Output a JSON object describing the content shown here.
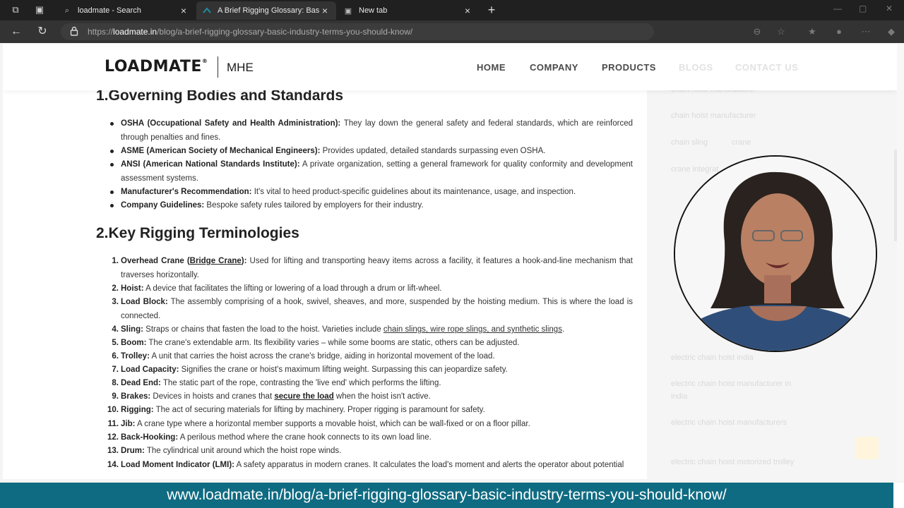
{
  "browser": {
    "tabs": [
      {
        "title": "loadmate - Search",
        "icon": "search-icon"
      },
      {
        "title": "A Brief Rigging Glossary: Basic Ind",
        "icon": "site-favicon"
      },
      {
        "title": "New tab",
        "icon": "newtab-icon"
      }
    ],
    "url": {
      "scheme": "https://",
      "host": "loadmate.in",
      "path": "/blog/a-brief-rigging-glossary-basic-industry-terms-you-should-know/"
    }
  },
  "site": {
    "logo": {
      "brand": "LOADMATE",
      "reg": "®",
      "sub": "MHE"
    },
    "nav": [
      "HOME",
      "COMPANY",
      "PRODUCTS",
      "BLOGS",
      "CONTACT US"
    ]
  },
  "article": {
    "section1": {
      "heading": "1.Governing Bodies and Standards",
      "items": [
        {
          "term": "OSHA (Occupational Safety and Health Administration):",
          "text": " They lay down the general safety and federal standards, which are reinforced through penalties and fines."
        },
        {
          "term": "ASME (American Society of Mechanical Engineers):",
          "text": " Provides updated, detailed standards surpassing even OSHA."
        },
        {
          "term": "ANSI (American National Standards Institute):",
          "text": " A private organization, setting a general framework for quality conformity and development assessment systems."
        },
        {
          "term": "Manufacturer's Recommendation:",
          "text": " It's vital to heed product-specific guidelines about its maintenance, usage, and inspection."
        },
        {
          "term": "Company Guidelines:",
          "text": " Bespoke safety rules tailored by employers for their industry."
        }
      ]
    },
    "section2": {
      "heading": "2.Key Rigging Terminologies",
      "items": [
        {
          "n": "1.",
          "term": "Overhead Crane (",
          "link": "Bridge Crane",
          "term2": "):",
          "text": " Used for lifting and transporting heavy items across a facility, it features a hook-and-line mechanism that traverses horizontally."
        },
        {
          "n": "2.",
          "term": "Hoist:",
          "text": " A device that facilitates the lifting or lowering of a load through a drum or lift-wheel."
        },
        {
          "n": "3.",
          "term": "Load Block:",
          "text": " The assembly comprising of a hook, swivel, sheaves, and more, suspended by the hoisting medium. This is where the load is connected."
        },
        {
          "n": "4.",
          "term": "Sling:",
          "text": " Straps or chains that fasten the load to the hoist. Varieties include ",
          "link": "chain slings, wire rope slings, and synthetic slings",
          "after": "."
        },
        {
          "n": "5.",
          "term": "Boom:",
          "text": " The crane's extendable arm. Its flexibility varies – while some booms are static, others can be adjusted."
        },
        {
          "n": "6.",
          "term": "Trolley:",
          "text": " A unit that carries the hoist across the crane's bridge, aiding in horizontal movement of the load."
        },
        {
          "n": "7.",
          "term": "Load Capacity:",
          "text": " Signifies the crane or hoist's maximum lifting weight. Surpassing this can jeopardize safety."
        },
        {
          "n": "8.",
          "term": "Dead End:",
          "text": " The static part of the rope, contrasting the 'live end' which performs the lifting."
        },
        {
          "n": "9.",
          "term": "Brakes:",
          "text": " Devices in hoists and cranes that ",
          "link": "secure the load",
          "after": " when the hoist isn't active."
        },
        {
          "n": "10.",
          "term": "Rigging:",
          "text": " The act of securing materials for lifting by machinery. Proper rigging is paramount for safety."
        },
        {
          "n": "11.",
          "term": "Jib:",
          "text": " A crane type where a horizontal member supports a movable hoist, which can be wall-fixed or on a floor pillar."
        },
        {
          "n": "12.",
          "term": "Back-Hooking:",
          "text": " A perilous method where the crane hook connects to its own load line."
        },
        {
          "n": "13.",
          "term": "Drum:",
          "text": " The cylindrical unit around which the hoist rope winds."
        },
        {
          "n": "14.",
          "term": "Load Moment Indicator (LMI):",
          "text": " A safety apparatus in modern cranes. It calculates the load's moment and alerts the operator about potential"
        }
      ]
    }
  },
  "sidebar": {
    "links": [
      "chain hoist manufacturer",
      "chain hoist manufacturer",
      "chain sling",
      "crane",
      "crane integrat",
      "electric chain hoist india",
      "electric chain hoist manufacturer in india",
      "electric chain hoist manufacturers",
      "electric chain hoist motorized trolley"
    ]
  },
  "caption": {
    "text": "www.loadmate.in/blog/a-brief-rigging-glossary-basic-industry-terms-you-should-know/"
  }
}
